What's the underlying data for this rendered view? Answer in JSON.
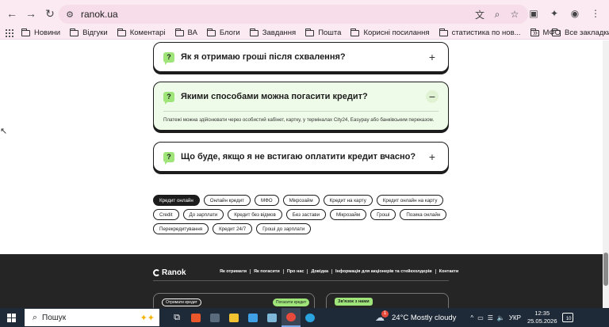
{
  "browser": {
    "url": "ranok.ua",
    "bookmarks": [
      "Новини",
      "Відгуки",
      "Коментарі",
      "ВА",
      "Блоги",
      "Завдання",
      "Пошта",
      "Корисні посилання",
      "статистика по нов...",
      "МФО"
    ],
    "more_glyph": "»",
    "all_bookmarks": "Все закладки"
  },
  "faq": {
    "items": [
      {
        "question": "Як я отримаю гроші після схвалення?",
        "toggle": "+"
      },
      {
        "question": "Якими способами можна погасити кредит?",
        "toggle": "−",
        "answer": "Платежі можна здійснювати через особистий кабінет, картку, у терміналах City24, Easypay або банківським переказом."
      },
      {
        "question": "Що буде, якщо я не встигаю оплатити кредит вчасно?",
        "toggle": "+"
      }
    ],
    "bubble_glyph": "?"
  },
  "tags": [
    "Кредит онлайн",
    "Онлайн кредит",
    "МФО",
    "Мікрозайм",
    "Кредит на карту",
    "Кредит онлайн на карту",
    "Credit",
    "До зарплати",
    "Кредит без відмов",
    "Без застави",
    "Мікрозайм",
    "Гроші",
    "Позика онлайн",
    "Перекредитування",
    "Кредит 24/7",
    "Гроші до зарплати"
  ],
  "footer": {
    "logo": "Ranok",
    "nav": [
      "Як отримати",
      "Як погасити",
      "Про нас",
      "Довідка",
      "Інформація для акціонерів та стейкхолдерів",
      "Контакти"
    ],
    "card_pill_dark": "Отримати кредит",
    "card_pill_green": "Погасити кредит",
    "contact_pill": "Зв'язок з нами"
  },
  "taskbar": {
    "search_placeholder": "Пошук",
    "weather": "24°C  Mostly cloudy",
    "language": "УКР",
    "time": "12:35",
    "date": "25.05.2026",
    "notifications": "10",
    "taskbar_badge": "1"
  },
  "colors": {
    "accent_green": "#9fe57a",
    "open_card_bg": "#effbe9",
    "dark": "#1c1c1c",
    "chrome_bg": "#fbeaf2",
    "taskbar_bg": "#1f2a38"
  }
}
